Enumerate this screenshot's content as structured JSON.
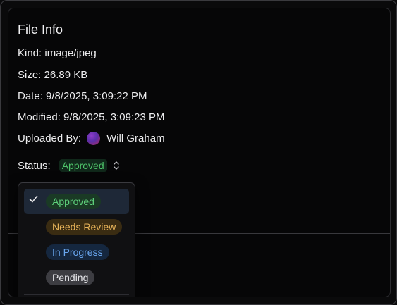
{
  "file_info": {
    "title": "File Info",
    "kind_label": "Kind:",
    "kind_value": "image/jpeg",
    "size_label": "Size:",
    "size_value": "26.89 KB",
    "date_label": "Date:",
    "date_value": "9/8/2025, 3:09:22 PM",
    "modified_label": "Modified:",
    "modified_value": "9/8/2025, 3:09:23 PM",
    "uploaded_by_label": "Uploaded By:",
    "uploaded_by_name": "Will Graham",
    "status_label": "Status:",
    "status_value": "Approved",
    "status_chevron_icon": "chevron-up-down-icon"
  },
  "status_dropdown": {
    "options": [
      {
        "label": "Approved",
        "selected": true,
        "color": "#5fd17c"
      },
      {
        "label": "Needs Review",
        "selected": false,
        "color": "#e9b55a"
      },
      {
        "label": "In Progress",
        "selected": false,
        "color": "#6aa7f0"
      },
      {
        "label": "Pending",
        "selected": false,
        "color": "#e6e6ea"
      }
    ],
    "check_icon": "checkmark-icon"
  }
}
